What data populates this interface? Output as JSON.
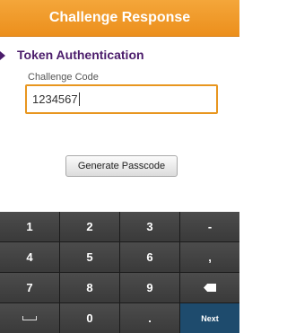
{
  "header": {
    "title": "Challenge Response"
  },
  "section": {
    "title": "Token Authentication"
  },
  "challenge": {
    "label": "Challenge Code",
    "value": "1234567"
  },
  "actions": {
    "generate_label": "Generate Passcode"
  },
  "keyboard": {
    "keys": [
      "1",
      "2",
      "3",
      "-",
      "4",
      "5",
      "6",
      ",",
      "7",
      "8",
      "9",
      "backspace",
      "space",
      "0",
      ".",
      "Next"
    ],
    "labels": {
      "k1": "1",
      "k2": "2",
      "k3": "3",
      "dash": "-",
      "k4": "4",
      "k5": "5",
      "k6": "6",
      "comma": ",",
      "k7": "7",
      "k8": "8",
      "k9": "9",
      "k0": "0",
      "dot": ".",
      "next": "Next"
    }
  },
  "colors": {
    "accent": "#ec8f1c",
    "title_text": "#4b1c6b",
    "next_key": "#1e4b6d"
  }
}
